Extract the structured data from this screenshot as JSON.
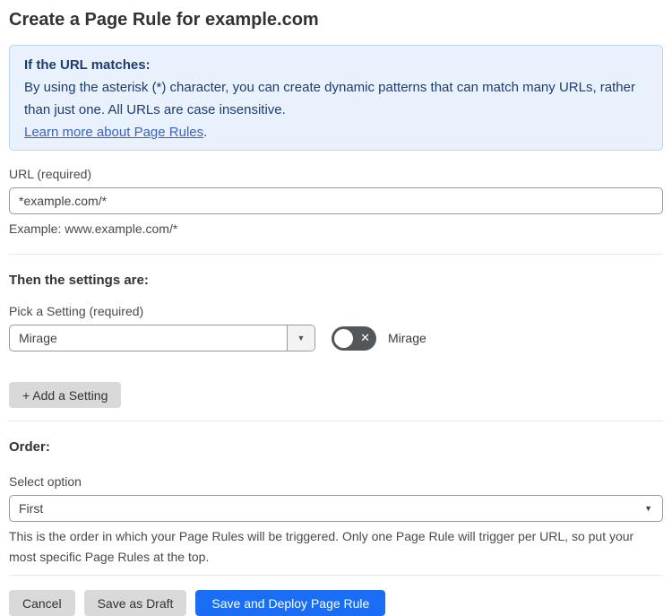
{
  "page": {
    "title": "Create a Page Rule for example.com"
  },
  "info_box": {
    "heading": "If the URL matches:",
    "body": "By using the asterisk (*) character, you can create dynamic patterns that can match many URLs, rather than just one. All URLs are case insensitive.",
    "link_label": "Learn more about Page Rules",
    "link_suffix": "."
  },
  "url_section": {
    "label": "URL (required)",
    "value": "*example.com/*",
    "example": "Example: www.example.com/*"
  },
  "settings_section": {
    "heading": "Then the settings are:",
    "picker_label": "Pick a Setting (required)",
    "selected_setting": "Mirage",
    "toggle_label": "Mirage",
    "toggle_state": "off",
    "add_setting_label": "+ Add a Setting"
  },
  "order_section": {
    "heading": "Order:",
    "label": "Select option",
    "selected_option": "First",
    "help_text": "This is the order in which your Page Rules will be triggered. Only one Page Rule will trigger per URL, so put your most specific Page Rules at the top."
  },
  "footer": {
    "cancel_label": "Cancel",
    "save_draft_label": "Save as Draft",
    "save_deploy_label": "Save and Deploy Page Rule"
  },
  "icons": {
    "dropdown_arrow": "▼",
    "toggle_off_x": "✕"
  },
  "colors": {
    "accent_blue": "#1a6ef5",
    "info_bg": "#e9f2fc",
    "info_border": "#b9d5f1",
    "info_text": "#1e3c6e",
    "link_blue": "#3b63c8",
    "toggle_off_bg": "#53565b",
    "button_gray": "#d9d9d9"
  }
}
